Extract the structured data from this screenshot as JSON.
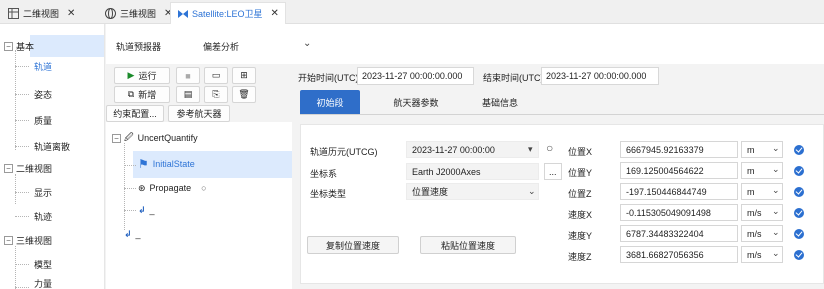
{
  "tabs": [
    {
      "label": "二维视图",
      "icon": "grid-icon"
    },
    {
      "label": "三维视图",
      "icon": "globe-icon"
    },
    {
      "label": "Satellite:LEO卫星",
      "icon": "satellite-icon"
    }
  ],
  "left_tree": {
    "groups": [
      {
        "label": "基本",
        "items": [
          "轨道",
          "姿态",
          "质量",
          "轨道离散"
        ]
      },
      {
        "label": "二维视图",
        "items": [
          "显示",
          "轨迹"
        ]
      },
      {
        "label": "三维视图",
        "items": [
          "模型",
          "力量"
        ]
      }
    ]
  },
  "top": {
    "label": "轨道预报器",
    "value": "偏差分析"
  },
  "toolbar": {
    "run": "运行",
    "new": "新增",
    "constraint": "约束配置...",
    "ref_spacecraft": "参考航天器"
  },
  "object_tree": {
    "root": "UncertQuantify",
    "initial": "InitialState",
    "propagate": "Propagate",
    "ret1": "_",
    "ret2": "_"
  },
  "time": {
    "start_label": "开始时间(UTC)",
    "start_value": "2023-11-27 00:00:00.000",
    "end_label": "结束时间(UTC)",
    "end_value": "2023-11-27 00:00:00.000"
  },
  "subtabs": [
    "初始段",
    "航天器参数",
    "基础信息"
  ],
  "form": {
    "epoch_label": "轨道历元(UTCG)",
    "epoch_value": "2023-11-27 00:00:00",
    "coord_label": "坐标系",
    "coord_value": "Earth J2000Axes",
    "coord_btn": "...",
    "type_label": "坐标类型",
    "type_value": "位置速度",
    "copy_btn": "复制位置速度",
    "paste_btn": "粘贴位置速度",
    "rows": [
      {
        "label": "位置X",
        "value": "6667945.92163379",
        "unit": "m"
      },
      {
        "label": "位置Y",
        "value": "169.125004564622",
        "unit": "m"
      },
      {
        "label": "位置Z",
        "value": "-197.150446844749",
        "unit": "m"
      },
      {
        "label": "速度X",
        "value": "-0.115305049091498",
        "unit": "m/s"
      },
      {
        "label": "速度Y",
        "value": "6787.34483322404",
        "unit": "m/s"
      },
      {
        "label": "速度Z",
        "value": "3681.66827056356",
        "unit": "m/s"
      }
    ]
  },
  "colors": {
    "accent": "#2f6ec9",
    "selection": "#dceafd",
    "check": "#2b6fd0"
  }
}
